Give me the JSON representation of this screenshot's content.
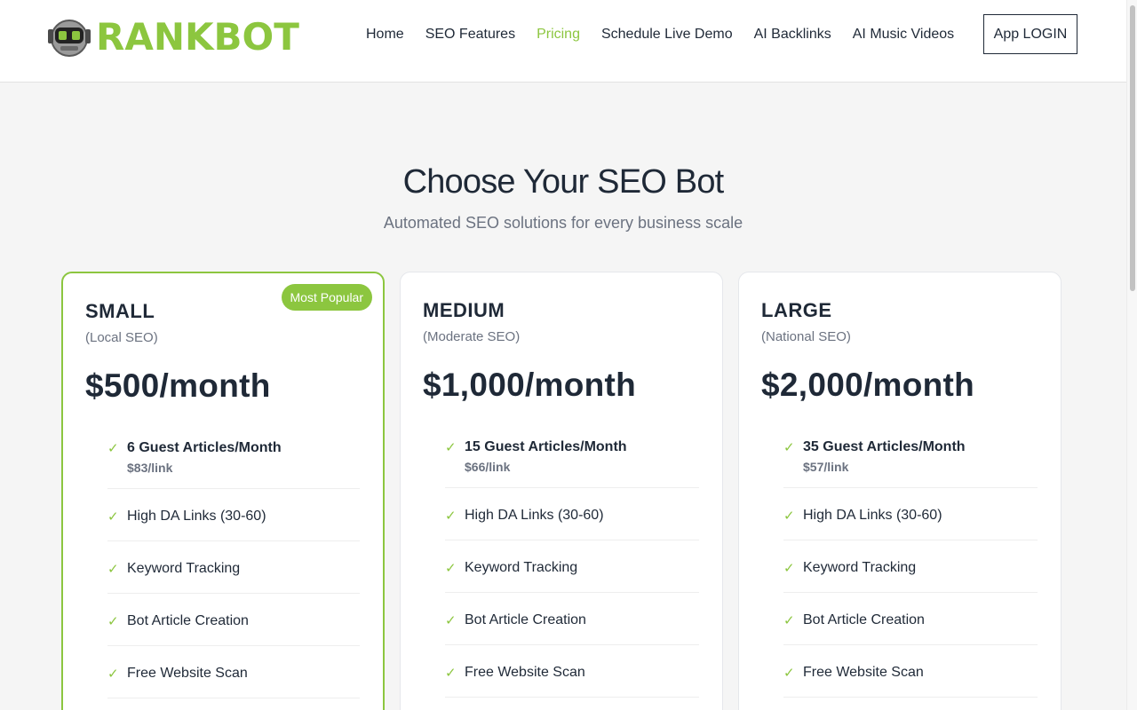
{
  "brand": {
    "name": "RANKBOT",
    "accent": "#8cc63f"
  },
  "nav": {
    "items": [
      "Home",
      "SEO Features",
      "Pricing",
      "Schedule Live Demo",
      "AI Backlinks",
      "AI Music Videos"
    ],
    "active": "Pricing",
    "login_label": "App LOGIN"
  },
  "hero": {
    "title": "Choose Your SEO Bot",
    "subtitle": "Automated SEO solutions for every business scale"
  },
  "plans": [
    {
      "name": "SMALL",
      "scope": "(Local SEO)",
      "price": "$500/month",
      "badge": "Most Popular",
      "articles": "6 Guest Articles/Month",
      "per_link": "$83/link",
      "features": [
        "High DA Links (30-60)",
        "Keyword Tracking",
        "Bot Article Creation",
        "Free Website Scan"
      ]
    },
    {
      "name": "MEDIUM",
      "scope": "(Moderate SEO)",
      "price": "$1,000/month",
      "articles": "15 Guest Articles/Month",
      "per_link": "$66/link",
      "features": [
        "High DA Links (30-60)",
        "Keyword Tracking",
        "Bot Article Creation",
        "Free Website Scan"
      ]
    },
    {
      "name": "LARGE",
      "scope": "(National SEO)",
      "price": "$2,000/month",
      "articles": "35 Guest Articles/Month",
      "per_link": "$57/link",
      "features": [
        "High DA Links (30-60)",
        "Keyword Tracking",
        "Bot Article Creation",
        "Free Website Scan"
      ]
    }
  ],
  "icons": {
    "check": "✓"
  }
}
